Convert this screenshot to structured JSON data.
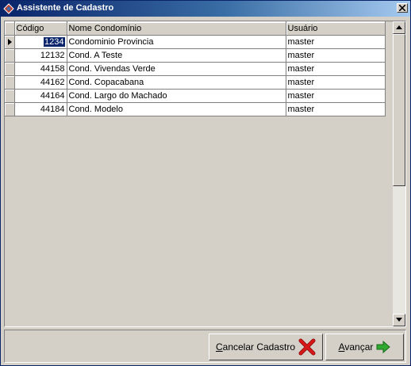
{
  "window": {
    "title": "Assistente de Cadastro"
  },
  "grid": {
    "columns": [
      "Código",
      "Nome Condomínio",
      "Usuário"
    ],
    "rows": [
      {
        "codigo": "1234",
        "nome": "Condominio Provincia",
        "usuario": "master"
      },
      {
        "codigo": "12132",
        "nome": "Cond. A Teste",
        "usuario": "master"
      },
      {
        "codigo": "44158",
        "nome": "Cond. Vivendas Verde",
        "usuario": "master"
      },
      {
        "codigo": "44162",
        "nome": "Cond. Copacabana",
        "usuario": "master"
      },
      {
        "codigo": "44164",
        "nome": "Cond. Largo do Machado",
        "usuario": "master"
      },
      {
        "codigo": "44184",
        "nome": "Cond. Modelo",
        "usuario": "master"
      }
    ]
  },
  "buttons": {
    "cancel": {
      "hotkey": "C",
      "rest": "ancelar Cadastro",
      "icon": "red-x-icon"
    },
    "next": {
      "hotkey": "A",
      "rest": "vançar",
      "icon": "green-arrow-right-icon"
    }
  },
  "colors": {
    "titlebar": "#0a246a",
    "selection": "#0a246a",
    "cancel_icon": "#d81818",
    "next_icon": "#2ea82e"
  }
}
